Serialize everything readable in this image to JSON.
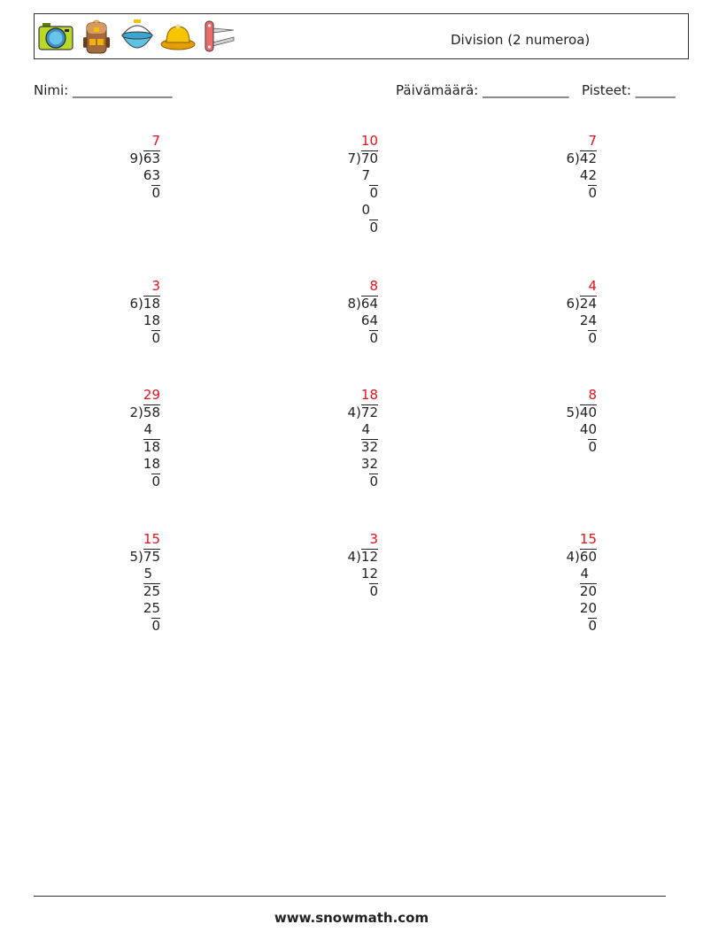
{
  "header": {
    "title": "Division (2 numeroa)",
    "icons": [
      "camera-icon",
      "backpack-icon",
      "bucket-icon",
      "hat-icon",
      "pocket-knife-icon"
    ]
  },
  "info": {
    "name_label": "Nimi: _______________",
    "date_label": "Päivämäärä: _____________",
    "score_label": "Pisteet: ______"
  },
  "problems": [
    {
      "divisor": "9",
      "dividend": "63",
      "quotient": "7",
      "steps": [
        "63",
        "0"
      ]
    },
    {
      "divisor": "7",
      "dividend": "70",
      "quotient": "10",
      "steps": [
        "7",
        "0",
        "0",
        "0"
      ]
    },
    {
      "divisor": "6",
      "dividend": "42",
      "quotient": "7",
      "steps": [
        "42",
        "0"
      ]
    },
    {
      "divisor": "6",
      "dividend": "18",
      "quotient": "3",
      "steps": [
        "18",
        "0"
      ]
    },
    {
      "divisor": "8",
      "dividend": "64",
      "quotient": "8",
      "steps": [
        "64",
        "0"
      ]
    },
    {
      "divisor": "6",
      "dividend": "24",
      "quotient": "4",
      "steps": [
        "24",
        "0"
      ]
    },
    {
      "divisor": "2",
      "dividend": "58",
      "quotient": "29",
      "steps": [
        "4",
        "18",
        "18",
        "0"
      ]
    },
    {
      "divisor": "4",
      "dividend": "72",
      "quotient": "18",
      "steps": [
        "4",
        "32",
        "32",
        "0"
      ]
    },
    {
      "divisor": "5",
      "dividend": "40",
      "quotient": "8",
      "steps": [
        "40",
        "0"
      ]
    },
    {
      "divisor": "5",
      "dividend": "75",
      "quotient": "15",
      "steps": [
        "5",
        "25",
        "25",
        "0"
      ]
    },
    {
      "divisor": "4",
      "dividend": "12",
      "quotient": "3",
      "steps": [
        "12",
        "0"
      ]
    },
    {
      "divisor": "4",
      "dividend": "60",
      "quotient": "15",
      "steps": [
        "4",
        "20",
        "20",
        "0"
      ]
    }
  ],
  "footer": {
    "url": "www.snowmath.com"
  },
  "colors": {
    "quotient": "#e8101a"
  }
}
